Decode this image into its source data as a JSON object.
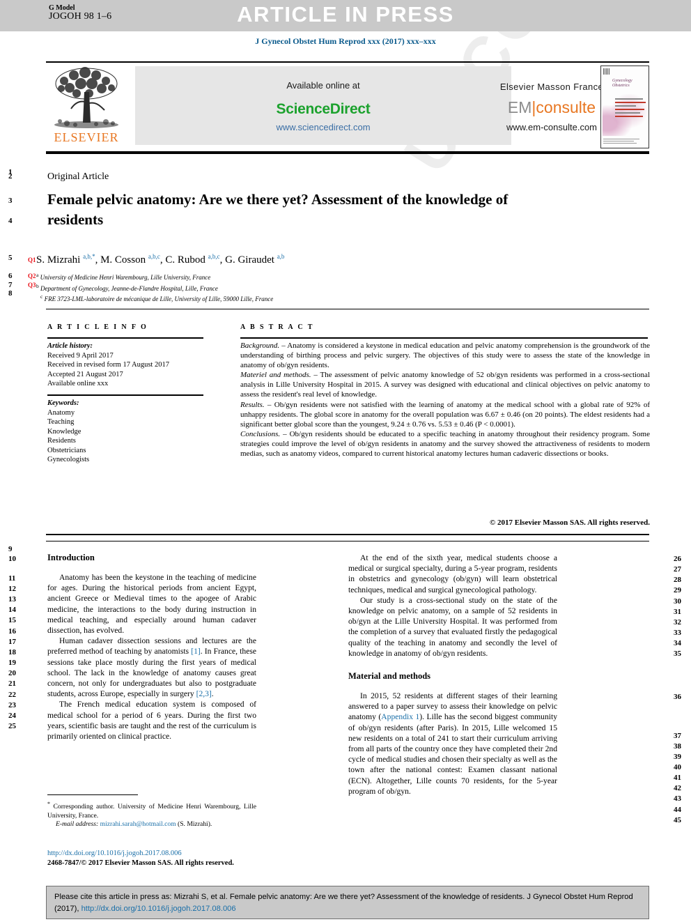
{
  "header": {
    "g_model_label": "G Model",
    "g_model_code": "JOGOH 98 1–6",
    "article_in_press": "ARTICLE IN PRESS",
    "journal_citation": "J Gynecol Obstet Hum Reprod xxx (2017) xxx–xxx"
  },
  "masthead": {
    "publisher_logo_word": "ELSEVIER",
    "available_online": "Available online at",
    "sciencedirect_logo": "ScienceDirect",
    "sciencedirect_url": "www.sciencedirect.com",
    "elsevier_masson": "Elsevier Masson France",
    "em_logo_left": "EM",
    "em_logo_bar": "|",
    "em_logo_right": "consulte",
    "em_url": "www.em-consulte.com",
    "cover_title": "Gynecology Obstetrics"
  },
  "article": {
    "type": "Original Article",
    "title": "Female pelvic anatomy: Are we there yet? Assessment of the knowledge of residents",
    "authors_html": "S. Mizrahi <sup>a,b,*</sup>, M. Cosson <sup>a,b,c</sup>, C. Rubod <sup>a,b,c</sup>, G. Giraudet <sup>a,b</sup>",
    "affiliations": [
      "University of Medicine Henri Warembourg, Lille University, France",
      "Department of Gynecology, Jeanne-de-Flandre Hospital, Lille, France",
      "FRE 3723-LML-laboratoire de mécanique de Lille, University of Lille, 59000 Lille, France"
    ],
    "affiliation_marks": [
      "a",
      "b",
      "c"
    ],
    "query_tags": [
      "Q1",
      "Q2",
      "Q3"
    ]
  },
  "article_info": {
    "heading": "A R T I C L E  I N F O",
    "history_label": "Article history:",
    "history": [
      "Received 9 April 2017",
      "Received in revised form 17 August 2017",
      "Accepted 21 August 2017",
      "Available online xxx"
    ],
    "keywords_label": "Keywords:",
    "keywords": [
      "Anatomy",
      "Teaching",
      "Knowledge",
      "Residents",
      "Obstetricians",
      "Gynecologists"
    ]
  },
  "abstract": {
    "heading": "A B S T R A C T",
    "sections": [
      {
        "label": "Background.",
        "text": " – Anatomy is considered a keystone in medical education and pelvic anatomy comprehension is the groundwork of the understanding of birthing process and pelvic surgery. The objectives of this study were to assess the state of the knowledge in anatomy of ob/gyn residents."
      },
      {
        "label": "Materiel and methods.",
        "text": " – The assessment of pelvic anatomy knowledge of 52 ob/gyn residents was performed in a cross-sectional analysis in Lille University Hospital in 2015. A survey was designed with educational and clinical objectives on pelvic anatomy to assess the resident's real level of knowledge."
      },
      {
        "label": "Results.",
        "text": " – Ob/gyn residents were not satisfied with the learning of anatomy at the medical school with a global rate of 92% of unhappy residents. The global score in anatomy for the overall population was 6.67 ± 0.46 (on 20 points). The eldest residents had a significant better global score than the youngest, 9.24 ± 0.76 vs. 5.53 ± 0.46 (P < 0.0001)."
      },
      {
        "label": "Conclusions.",
        "text": " – Ob/gyn residents should be educated to a specific teaching in anatomy throughout their residency program. Some strategies could improve the level of ob/gyn residents in anatomy and the survey showed the attractiveness of residents to modern medias, such as anatomy videos, compared to current historical anatomy lectures human cadaveric dissections or books."
      }
    ],
    "copyright": "© 2017 Elsevier Masson SAS. All rights reserved."
  },
  "body": {
    "left_column": {
      "heading": "Introduction",
      "paragraphs": [
        "Anatomy has been the keystone in the teaching of medicine for ages. During the historical periods from ancient Egypt, ancient Greece or Medieval times to the apogee of Arabic medicine, the interactions to the body during instruction in medical teaching, and especially around human cadaver dissection, has evolved.",
        "Human cadaver dissection sessions and lectures are the preferred method of teaching by anatomists [1]. In France, these sessions take place mostly during the first years of medical school. The lack in the knowledge of anatomy causes great concern, not only for undergraduates but also to postgraduate students, across Europe, especially in surgery [2,3].",
        "The French medical education system is composed of medical school for a period of 6 years. During the first two years, scientific basis are taught and the rest of the curriculum is primarily oriented on clinical practice."
      ]
    },
    "right_column": {
      "paragraphs_before_heading": [
        "At the end of the sixth year, medical students choose a medical or surgical specialty, during a 5-year program, residents in obstetrics and gynecology (ob/gyn) will learn obstetrical techniques, medical and surgical gynecological pathology.",
        "Our study is a cross-sectional study on the state of the knowledge on pelvic anatomy, on a sample of 52 residents in ob/gyn at the Lille University Hospital. It was performed from the completion of a survey that evaluated firstly the pedagogical quality of the teaching in anatomy and secondly the level of knowledge in anatomy of ob/gyn residents."
      ],
      "heading": "Material and methods",
      "paragraphs_after_heading": [
        "In 2015, 52 residents at different stages of their learning answered to a paper survey to assess their knowledge on pelvic anatomy (Appendix 1). Lille has the second biggest community of ob/gyn residents (after Paris). In 2015, Lille welcomed 15 new residents on a total of 241 to start their curriculum arriving from all parts of the country once they have completed their 2nd cycle of medical studies and chosen their specialty as well as the town after the national contest: Examen classant national (ECN). Altogether, Lille counts 70 residents, for the 5-year program of ob/gyn."
      ],
      "inline_links": [
        "Appendix 1"
      ]
    },
    "inline_refs": [
      "[1]",
      "[2,3]"
    ]
  },
  "footnotes": {
    "corresponding_marker": "*",
    "corresponding_author": "Corresponding author. University of Medicine Henri Warembourg, Lille University, France.",
    "email_label": "E-mail address:",
    "email": "mizrahi.sarah@hotmail.com",
    "email_owner": "(S. Mizrahi).",
    "doi": "http://dx.doi.org/10.1016/j.jogoh.2017.08.006",
    "issn_line": "2468-7847/© 2017 Elsevier Masson SAS. All rights reserved."
  },
  "cite_box": {
    "text": "Please cite this article in press as: Mizrahi S, et al. Female pelvic anatomy: Are we there yet? Assessment of the knowledge of residents. J Gynecol Obstet Hum Reprod (2017), ",
    "doi": "http://dx.doi.org/10.1016/j.jogoh.2017.08.006"
  },
  "line_numbers": {
    "title_block": [
      "1",
      "2",
      "3",
      "4",
      "5",
      "6",
      "7",
      "8"
    ],
    "left_body": [
      "9",
      "10",
      "11",
      "12",
      "13",
      "14",
      "15",
      "16",
      "17",
      "18",
      "19",
      "20",
      "21",
      "22",
      "23",
      "24",
      "25"
    ],
    "right_body": [
      "26",
      "27",
      "28",
      "29",
      "30",
      "31",
      "32",
      "33",
      "34",
      "35",
      "36",
      "37",
      "38",
      "39",
      "40",
      "41",
      "42",
      "43",
      "44",
      "45"
    ]
  },
  "watermark": {
    "text": "UNCORRECTED PROOF"
  },
  "colors": {
    "journal_blue": "#0a5a8c",
    "link_blue": "#1a6fa8",
    "query_red": "#e8141c",
    "sciencedirect_green": "#1ca22e",
    "elsevier_orange": "#E87722",
    "banner_grey": "#c9c9c9"
  }
}
